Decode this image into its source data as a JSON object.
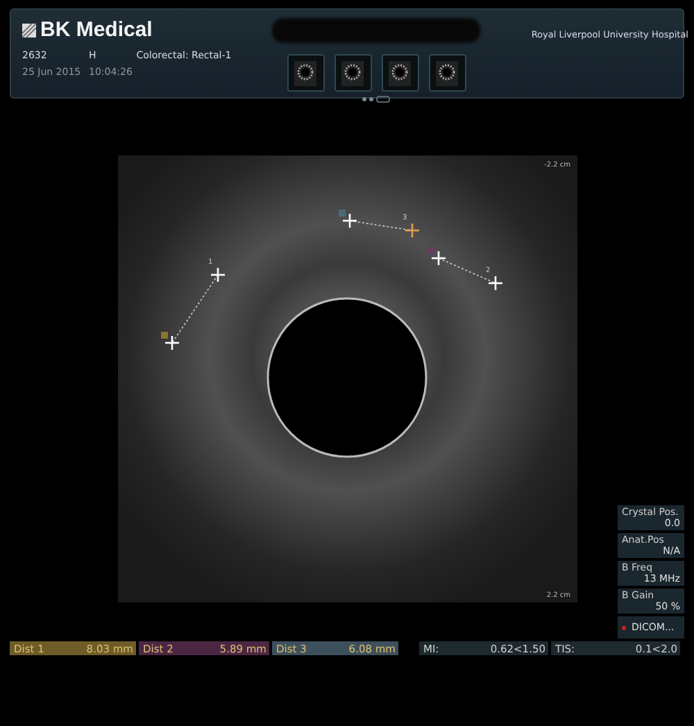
{
  "header": {
    "brand": "BK Medical",
    "hospital": "Royal Liverpool University Hospital",
    "patient_id": "2632",
    "sex": "H",
    "exam": "Colorectal: Rectal-1",
    "date": "25 Jun 2015",
    "time": "10:04:26",
    "pages": [
      {
        "selected": true
      },
      {
        "selected": true
      },
      {
        "selected": false
      }
    ]
  },
  "image": {
    "depth_top": "-2.2 cm",
    "depth_bottom": "2.2 cm",
    "measurements": [
      {
        "label": "1",
        "color": "#8a7430",
        "active": false
      },
      {
        "label": "2",
        "color": "#6a3a60",
        "active": false
      },
      {
        "label": "3",
        "color": "#4e6a7a",
        "active": true
      }
    ]
  },
  "parameters": [
    {
      "label": "Crystal Pos.",
      "value": "0.0"
    },
    {
      "label": "Anat.Pos",
      "value": "N/A"
    },
    {
      "label": "B Freq",
      "value": "13 MHz"
    },
    {
      "label": "B Gain",
      "value": "50 %"
    }
  ],
  "dicom_button": "DICOM...",
  "readouts": [
    {
      "label": "Dist 1",
      "value": "8.03 mm",
      "color": "#6e5c28"
    },
    {
      "label": "Dist 2",
      "value": "5.89 mm",
      "color": "#4c2744"
    },
    {
      "label": "Dist 3",
      "value": "6.08 mm",
      "color": "#3e505c"
    }
  ],
  "indices": [
    {
      "label": "MI:",
      "value": "0.62<1.50"
    },
    {
      "label": "TIS:",
      "value": "0.1<2.0"
    }
  ]
}
